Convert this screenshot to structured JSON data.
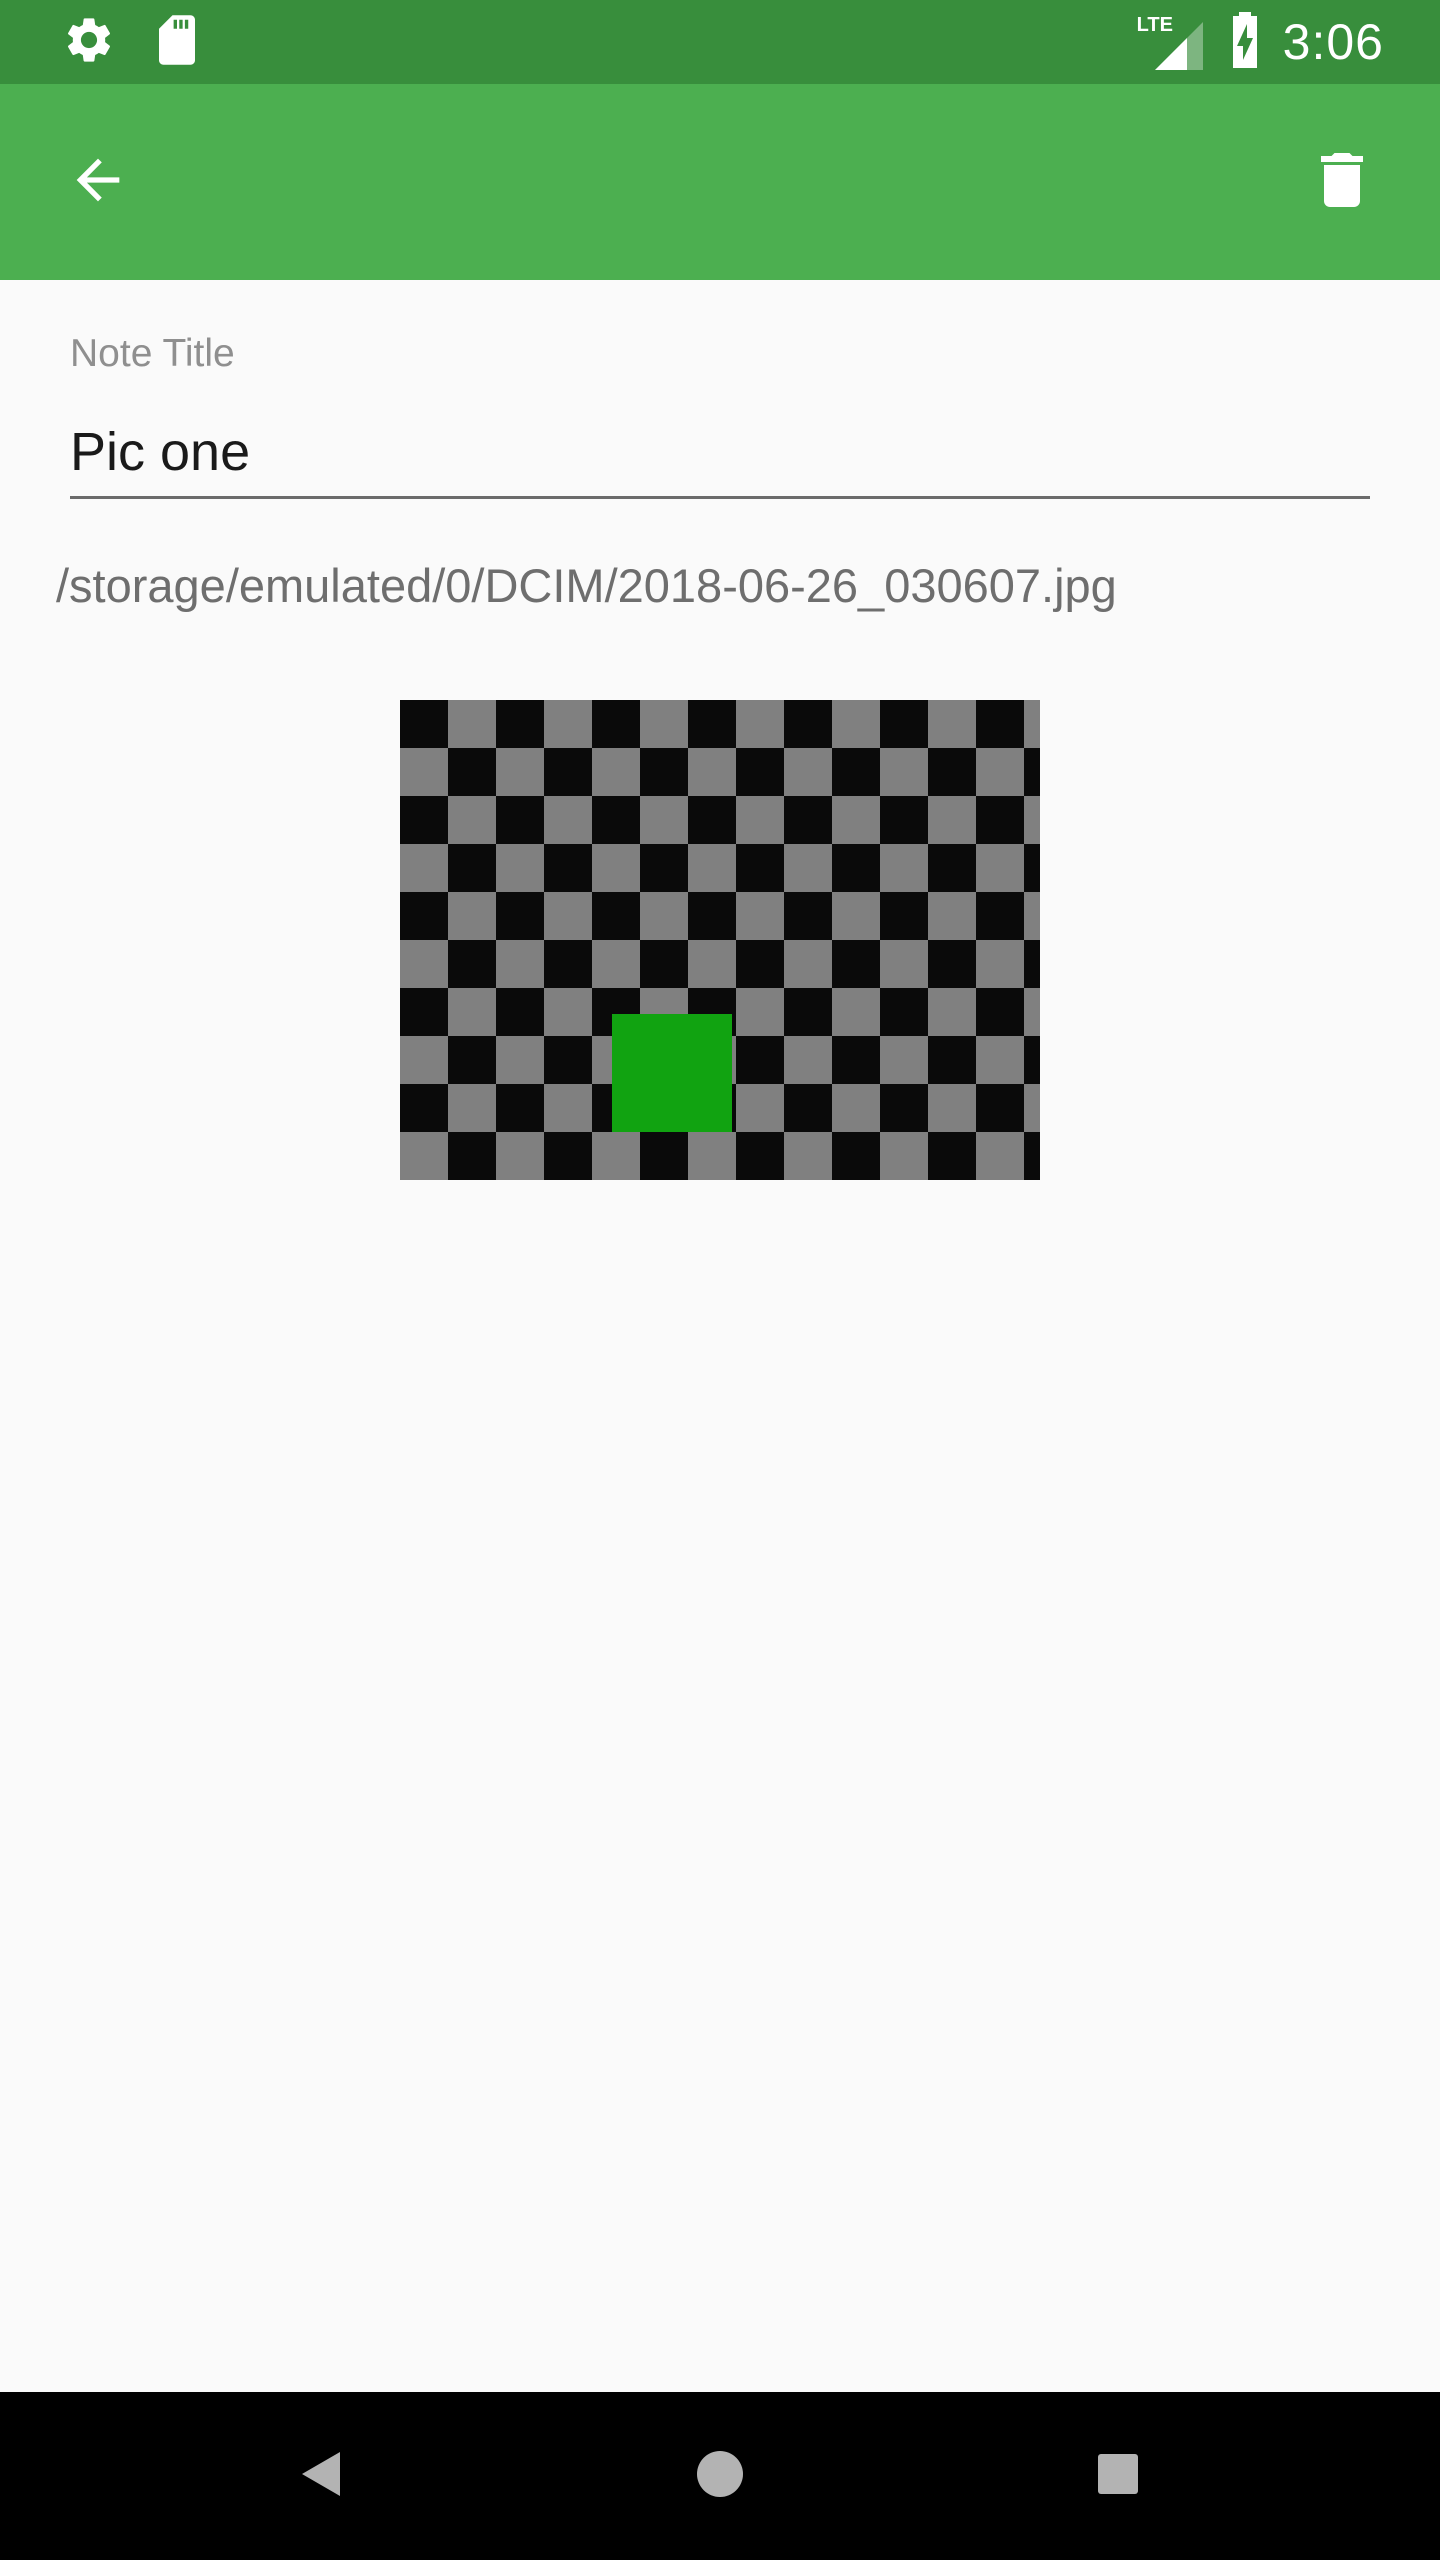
{
  "status_bar": {
    "time": "3:06",
    "network_label": "LTE",
    "icons": [
      "settings-icon",
      "sd-card-icon",
      "lte-signal-icon",
      "battery-charging-icon"
    ]
  },
  "app_bar": {
    "back_icon": "arrow-back-icon",
    "delete_icon": "trash-icon",
    "color": "#4caf50",
    "status_color": "#388e3c"
  },
  "note": {
    "title_label": "Note Title",
    "title_value": "Pic one",
    "file_path": "/storage/emulated/0/DCIM/2018-06-26_030607.jpg"
  },
  "nav_bar": {
    "icons": [
      "nav-back-icon",
      "nav-home-icon",
      "nav-recents-icon"
    ]
  }
}
